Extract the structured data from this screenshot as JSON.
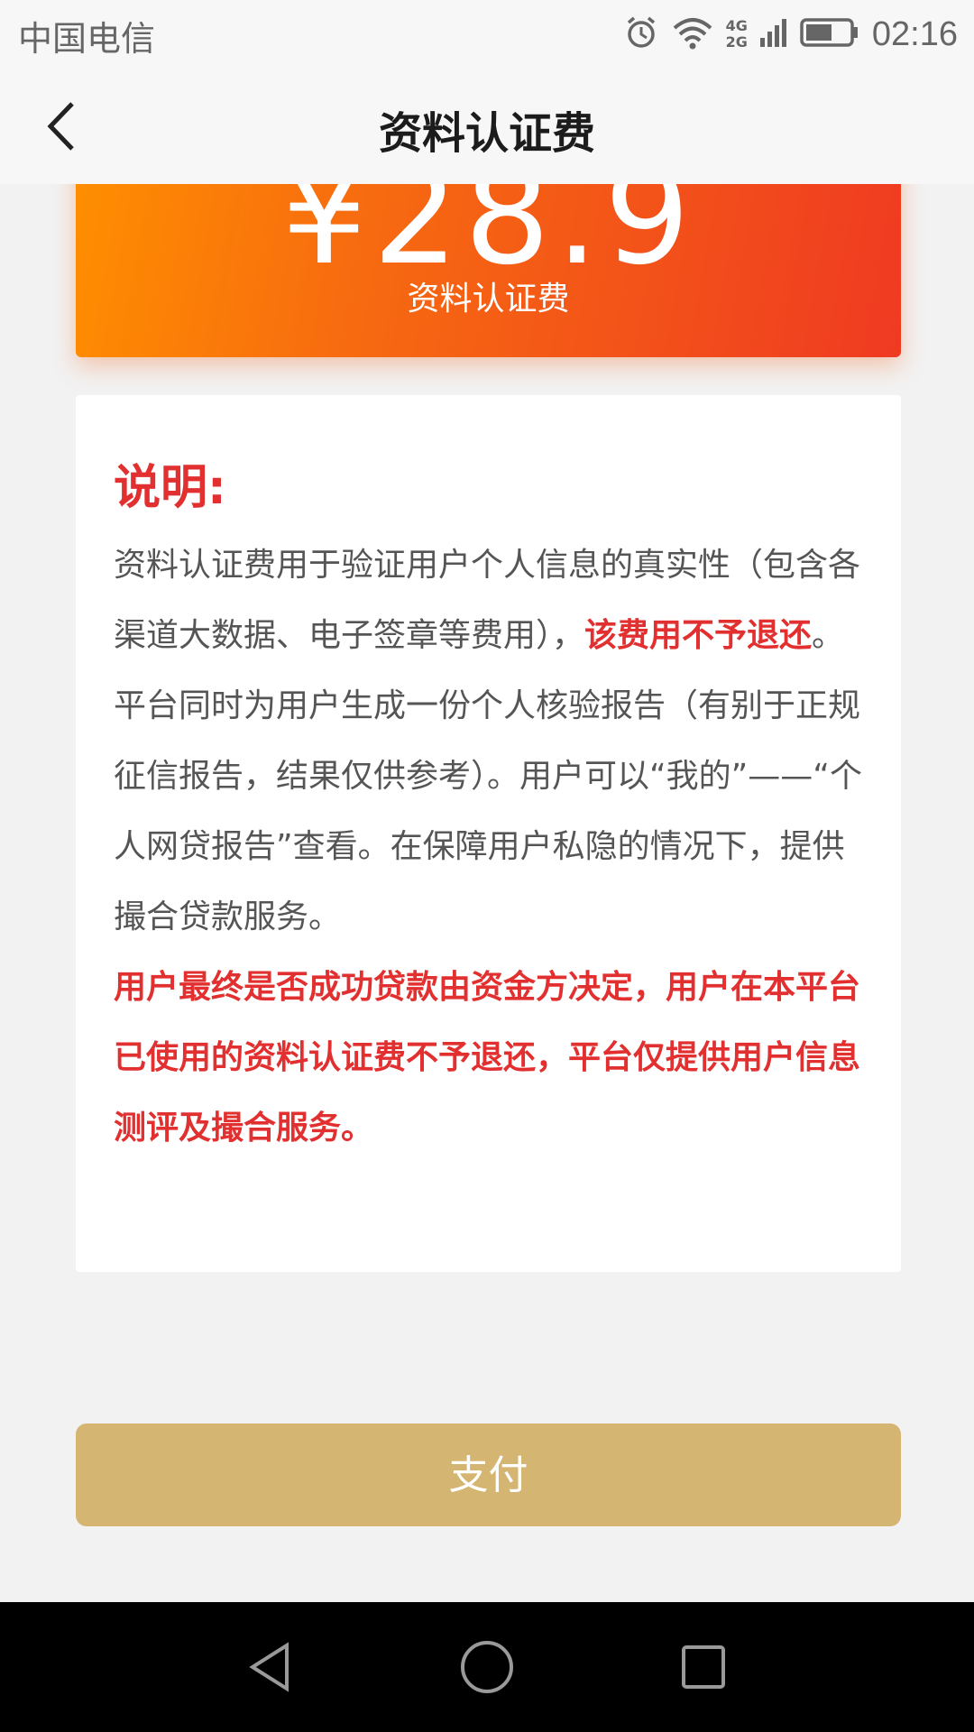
{
  "status_bar": {
    "carrier": "中国电信",
    "network_top": "4G",
    "network_bottom": "2G",
    "time": "02:16",
    "icons": [
      "alarm-icon",
      "wifi-icon",
      "signal-icon",
      "battery-icon"
    ]
  },
  "header": {
    "title": "资料认证费",
    "back_icon": "chevron-left-icon"
  },
  "price_card": {
    "amount": "¥28.9",
    "label": "资料认证费"
  },
  "description": {
    "title": "说明:",
    "part1": " 资料认证费用于验证用户个人信息的真实性（包含各渠道大数据、电子签章等费用），",
    "part2_red": "该费用不予退还",
    "part3": "。平台同时为用户生成一份个人核验报告（有别于正规征信报告，结果仅供参考）。用户可以“我的”——“个人网贷报告”查看。在保障用户私隐的情况下，提供撮合贷款服务。",
    "warning": "用户最终是否成功贷款由资金方决定，用户在本平台已使用的资料认证费不予退还，平台仅提供用户信息测评及撮合服务。"
  },
  "pay_button": {
    "label": "支付"
  },
  "nav_bar": {
    "icons": [
      "back-triangle-icon",
      "home-circle-icon",
      "recents-square-icon"
    ]
  },
  "colors": {
    "accent_red": "#e23030",
    "gradient_start": "#ff8f00",
    "gradient_end": "#ef3a22",
    "pay_button": "#d4b572"
  }
}
